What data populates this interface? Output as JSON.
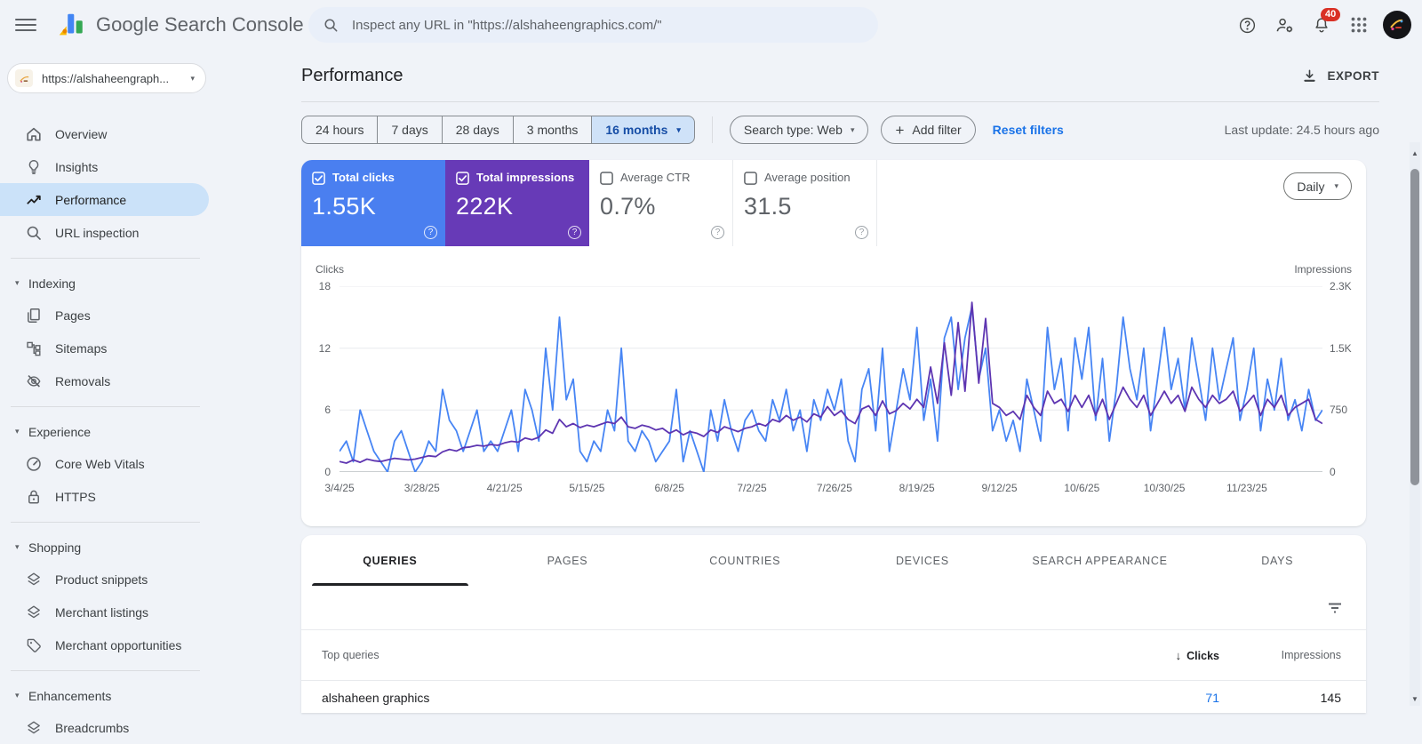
{
  "topbar": {
    "product_name": "Google Search Console",
    "search_placeholder": "Inspect any URL in \"https://alshaheengraphics.com/\"",
    "notification_count": "40"
  },
  "sidebar": {
    "property_label": "https://alshaheengraph...",
    "items": [
      {
        "label": "Overview",
        "icon": "home"
      },
      {
        "label": "Insights",
        "icon": "lightbulb"
      },
      {
        "label": "Performance",
        "icon": "trending",
        "active": true
      },
      {
        "label": "URL inspection",
        "icon": "search"
      }
    ],
    "groups": [
      {
        "label": "Indexing",
        "items": [
          {
            "label": "Pages",
            "icon": "pages"
          },
          {
            "label": "Sitemaps",
            "icon": "sitemaps"
          },
          {
            "label": "Removals",
            "icon": "visibility-off"
          }
        ]
      },
      {
        "label": "Experience",
        "items": [
          {
            "label": "Core Web Vitals",
            "icon": "gauge"
          },
          {
            "label": "HTTPS",
            "icon": "lock"
          }
        ]
      },
      {
        "label": "Shopping",
        "items": [
          {
            "label": "Product snippets",
            "icon": "layers"
          },
          {
            "label": "Merchant listings",
            "icon": "layers"
          },
          {
            "label": "Merchant opportunities",
            "icon": "tag"
          }
        ]
      },
      {
        "label": "Enhancements",
        "items": [
          {
            "label": "Breadcrumbs",
            "icon": "layers"
          }
        ]
      }
    ]
  },
  "header": {
    "title": "Performance",
    "export_label": "EXPORT"
  },
  "filters": {
    "date_ranges": [
      "24 hours",
      "7 days",
      "28 days",
      "3 months"
    ],
    "date_range_selected": "16 months",
    "search_type": "Search type: Web",
    "add_filter": "Add filter",
    "reset": "Reset filters",
    "last_update": "Last update: 24.5 hours ago"
  },
  "metrics": {
    "cards": [
      {
        "label": "Total clicks",
        "value": "1.55K",
        "checked": true,
        "bg": "#4a7ff0"
      },
      {
        "label": "Total impressions",
        "value": "222K",
        "checked": true,
        "bg": "#673ab7"
      },
      {
        "label": "Average CTR",
        "value": "0.7%",
        "checked": false
      },
      {
        "label": "Average position",
        "value": "31.5",
        "checked": false
      }
    ],
    "view_mode": "Daily"
  },
  "chart_data": {
    "type": "line",
    "left_axis": {
      "label": "Clicks",
      "ticks": [
        "18",
        "12",
        "6",
        "0"
      ],
      "max": 18
    },
    "right_axis": {
      "label": "Impressions",
      "ticks": [
        "2.3K",
        "1.5K",
        "750",
        "0"
      ],
      "max": 2300
    },
    "x_tick_labels": [
      "3/4/25",
      "3/28/25",
      "4/21/25",
      "5/15/25",
      "6/8/25",
      "7/2/25",
      "7/26/25",
      "8/19/25",
      "9/12/25",
      "10/6/25",
      "10/30/25",
      "11/23/25"
    ],
    "x_tick_step": 12,
    "grid": true,
    "series": [
      {
        "name": "Clicks",
        "axis": "left",
        "color": "#4785f4",
        "values": [
          2,
          3,
          1,
          6,
          4,
          2,
          1,
          0,
          3,
          4,
          2,
          0,
          1,
          3,
          2,
          8,
          5,
          4,
          2,
          4,
          6,
          2,
          3,
          2,
          4,
          6,
          2,
          8,
          6,
          3,
          12,
          6,
          15,
          7,
          9,
          2,
          1,
          3,
          2,
          6,
          4,
          12,
          3,
          2,
          4,
          3,
          1,
          2,
          3,
          8,
          1,
          4,
          2,
          0,
          6,
          3,
          7,
          4,
          2,
          5,
          6,
          4,
          3,
          7,
          5,
          8,
          4,
          6,
          2,
          7,
          5,
          8,
          6,
          9,
          3,
          1,
          8,
          10,
          4,
          12,
          2,
          6,
          10,
          7,
          14,
          5,
          9,
          3,
          13,
          15,
          8,
          13,
          16,
          9,
          12,
          4,
          6,
          3,
          5,
          2,
          9,
          6,
          3,
          14,
          8,
          11,
          4,
          13,
          9,
          14,
          5,
          11,
          3,
          8,
          15,
          10,
          7,
          12,
          4,
          9,
          14,
          8,
          11,
          6,
          13,
          9,
          5,
          12,
          7,
          10,
          13,
          5,
          8,
          12,
          4,
          9,
          6,
          11,
          5,
          7,
          4,
          8,
          5,
          6
        ]
      },
      {
        "name": "Impressions",
        "axis": "right",
        "color": "#5e35b1",
        "values": [
          130,
          110,
          150,
          120,
          160,
          140,
          130,
          150,
          170,
          160,
          150,
          160,
          180,
          200,
          190,
          250,
          280,
          260,
          300,
          310,
          330,
          320,
          340,
          330,
          360,
          380,
          370,
          420,
          400,
          430,
          520,
          480,
          650,
          560,
          600,
          550,
          580,
          560,
          590,
          620,
          600,
          680,
          560,
          540,
          580,
          560,
          520,
          540,
          480,
          520,
          460,
          500,
          480,
          440,
          520,
          490,
          560,
          530,
          500,
          540,
          560,
          600,
          570,
          650,
          620,
          700,
          640,
          680,
          620,
          720,
          680,
          810,
          700,
          760,
          650,
          600,
          780,
          820,
          700,
          880,
          720,
          760,
          850,
          780,
          900,
          800,
          1300,
          850,
          1600,
          950,
          1850,
          1000,
          2100,
          1100,
          1900,
          850,
          800,
          700,
          750,
          650,
          950,
          800,
          700,
          1000,
          850,
          900,
          750,
          950,
          800,
          950,
          700,
          900,
          650,
          850,
          1050,
          900,
          800,
          950,
          700,
          850,
          1000,
          850,
          950,
          750,
          1050,
          900,
          800,
          950,
          850,
          900,
          1000,
          750,
          850,
          950,
          700,
          900,
          800,
          950,
          700,
          800,
          850,
          900,
          650,
          600
        ]
      }
    ]
  },
  "tabs": {
    "items": [
      "QUERIES",
      "PAGES",
      "COUNTRIES",
      "DEVICES",
      "SEARCH APPEARANCE",
      "DAYS"
    ],
    "active_index": 0
  },
  "table": {
    "first_col_header": "Top queries",
    "clicks_header": "Clicks",
    "impressions_header": "Impressions",
    "rows": [
      {
        "query": "alshaheen graphics",
        "clicks": "71",
        "impressions": "145"
      }
    ]
  }
}
